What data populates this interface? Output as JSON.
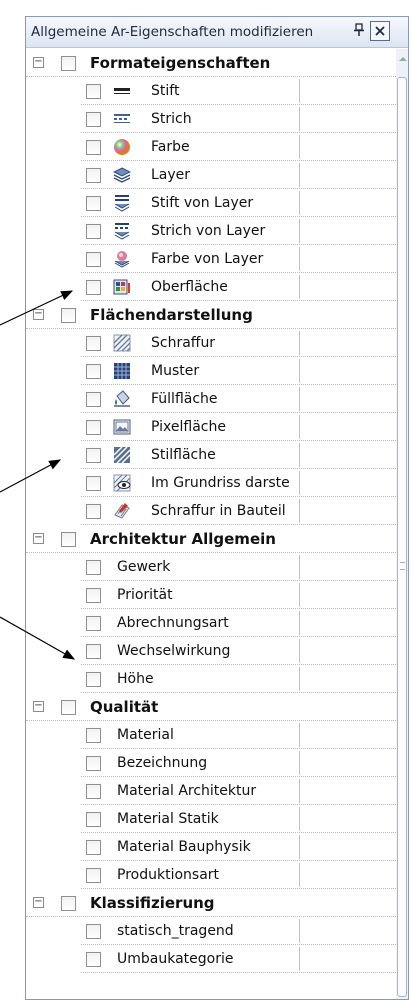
{
  "panel": {
    "title": "Allgemeine Ar-Eigenschaften modifizieren",
    "pin_glyph": "P",
    "close_glyph": "✕"
  },
  "groups": [
    {
      "label": "Formateigenschaften",
      "expander": "−",
      "items": [
        {
          "label": "Stift",
          "icon": "pen-icon"
        },
        {
          "label": "Strich",
          "icon": "line-style-icon"
        },
        {
          "label": "Farbe",
          "icon": "color-sphere-icon"
        },
        {
          "label": "Layer",
          "icon": "layer-stack-icon"
        },
        {
          "label": "Stift von Layer",
          "icon": "pen-from-layer-icon"
        },
        {
          "label": "Strich von Layer",
          "icon": "line-from-layer-icon"
        },
        {
          "label": "Farbe von Layer",
          "icon": "color-from-layer-icon"
        },
        {
          "label": "Oberfläche",
          "icon": "surface-icon"
        }
      ]
    },
    {
      "label": "Flächendarstellung",
      "expander": "−",
      "items": [
        {
          "label": "Schraffur",
          "icon": "hatching-icon"
        },
        {
          "label": "Muster",
          "icon": "pattern-icon"
        },
        {
          "label": "Füllfläche",
          "icon": "fill-bucket-icon"
        },
        {
          "label": "Pixelfläche",
          "icon": "pixel-image-icon"
        },
        {
          "label": "Stilfläche",
          "icon": "style-area-icon"
        },
        {
          "label": "Im Grundriss darste",
          "icon": "show-in-plan-icon"
        },
        {
          "label": "Schraffur in Bauteil",
          "icon": "hatch-in-component-icon"
        }
      ]
    },
    {
      "label": "Architektur Allgemein",
      "expander": "−",
      "items": [
        {
          "label": "Gewerk"
        },
        {
          "label": "Priorität"
        },
        {
          "label": "Abrechnungsart"
        },
        {
          "label": "Wechselwirkung"
        },
        {
          "label": "Höhe"
        }
      ]
    },
    {
      "label": "Qualität",
      "expander": "−",
      "items": [
        {
          "label": "Material"
        },
        {
          "label": "Bezeichnung"
        },
        {
          "label": "Material Architektur"
        },
        {
          "label": "Material Statik"
        },
        {
          "label": "Material Bauphysik"
        },
        {
          "label": "Produktionsart"
        }
      ]
    },
    {
      "label": "Klassifizierung",
      "expander": "−",
      "items": [
        {
          "label": "statisch_tragend"
        },
        {
          "label": "Umbaukategorie"
        }
      ]
    }
  ],
  "colors": {
    "panel_border": "#8c98ad",
    "annotation_arrow": "#000000"
  }
}
